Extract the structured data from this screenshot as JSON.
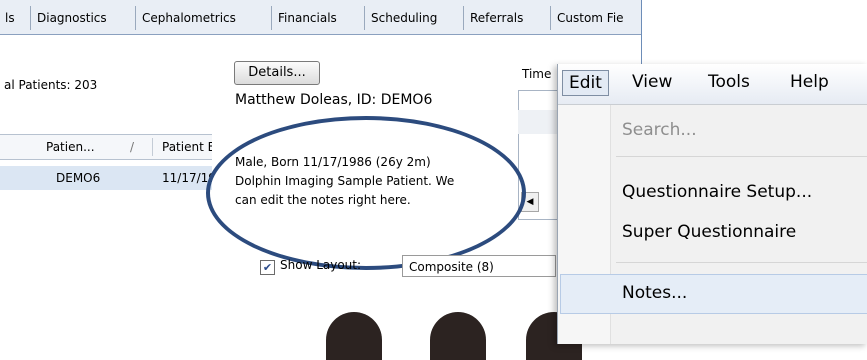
{
  "tabs": [
    "ls",
    "Diagnostics",
    "Cephalometrics",
    "Financials",
    "Scheduling",
    "Referrals",
    "Custom Fie"
  ],
  "total_patients_label": "al Patients: 203",
  "grid": {
    "col_patient_id": "Patien...",
    "sort_arrow": "/",
    "col_patient_birth": "Patient B",
    "row_id": "DEMO6",
    "row_birth": "11/17/19"
  },
  "details_button": "Details...",
  "patient_header": "Matthew Doleas, ID: DEMO6",
  "time_label": "Time",
  "notes": {
    "line1": "Male, Born 11/17/1986 (26y 2m)",
    "line2": "Dolphin Imaging Sample Patient. We",
    "line3": "can edit the notes right here."
  },
  "scroll_left_glyph": "◀",
  "show_layout": {
    "checked_glyph": "✔",
    "label": "Show Layout:",
    "value": "Composite (8)"
  },
  "menubar": {
    "edit": "Edit",
    "view": "View",
    "tools": "Tools",
    "help": "Help"
  },
  "edit_menu": {
    "search": "Search...",
    "questionnaire_setup": "Questionnaire Setup...",
    "super_questionnaire": "Super Questionnaire",
    "notes": "Notes..."
  },
  "colors": {
    "highlight_ellipse": "#2c4b7e",
    "menu_hover": "#e5edf7"
  }
}
